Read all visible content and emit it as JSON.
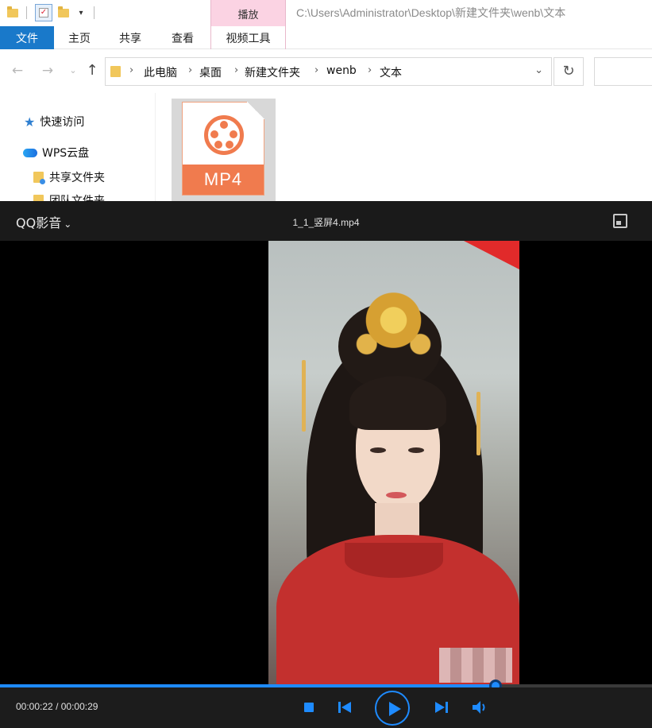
{
  "explorer": {
    "title_path": "C:\\Users\\Administrator\\Desktop\\新建文件夹\\wenb\\文本",
    "context_group_label": "播放",
    "ribbon_tabs": [
      {
        "label": "文件",
        "active": true
      },
      {
        "label": "主页"
      },
      {
        "label": "共享"
      },
      {
        "label": "查看"
      },
      {
        "label": "视频工具"
      }
    ],
    "breadcrumb": [
      "此电脑",
      "桌面",
      "新建文件夹",
      "wenb",
      "文本"
    ],
    "sidebar": [
      {
        "label": "快速访问",
        "icon": "star-icon"
      },
      {
        "label": "WPS云盘",
        "icon": "cloud-icon"
      },
      {
        "label": "共享文件夹",
        "icon": "folder-icon"
      },
      {
        "label": "团队文件夹",
        "icon": "folder-icon"
      }
    ],
    "file": {
      "type_label": "MP4",
      "icon": "mp4-file-icon"
    }
  },
  "player": {
    "brand": "QQ影音",
    "file_title": "1_1_竖屏4.mp4",
    "time_current": "00:00:22",
    "time_total": "00:00:29",
    "progress_fraction": 0.76,
    "accent_color": "#1e8bff",
    "controls": [
      "stop-icon",
      "previous-icon",
      "play-icon",
      "next-icon",
      "volume-icon"
    ]
  }
}
